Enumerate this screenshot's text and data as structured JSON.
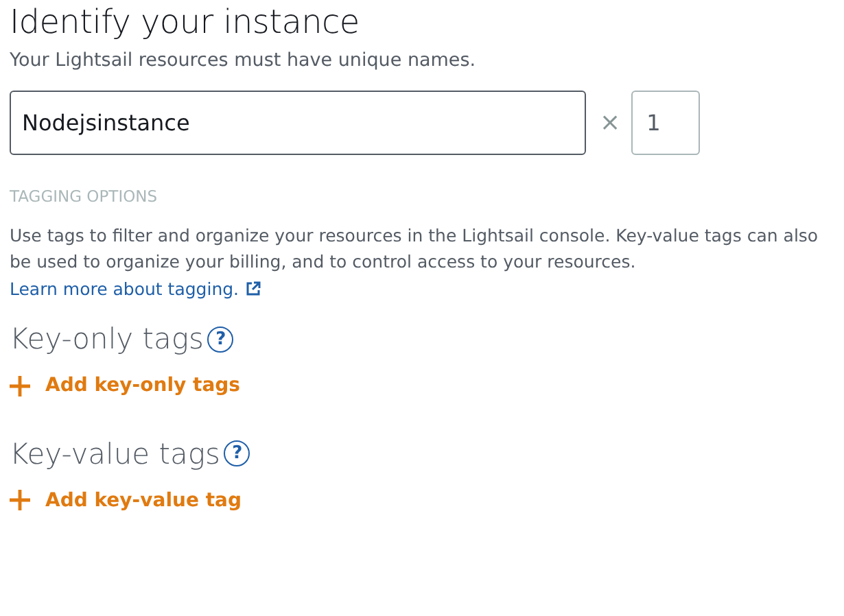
{
  "title": "Identify your instance",
  "subtitle": "Your Lightsail resources must have unique names.",
  "name_field": {
    "value": "Nodejsinstance",
    "focused": true
  },
  "multiply_sign": "×",
  "count_field": {
    "value": "1"
  },
  "tagging": {
    "label": "TAGGING OPTIONS",
    "description": "Use tags to filter and organize your resources in the Lightsail console. Key-value tags can also be used to organize your billing, and to control access to your resources.",
    "link": "Learn more about tagging."
  },
  "tag_sections": [
    {
      "title": "Key-only tags",
      "help": "?",
      "action": "Add key-only tags"
    },
    {
      "title": "Key-value tags",
      "help": "?",
      "action": "Add key-value tag"
    }
  ]
}
